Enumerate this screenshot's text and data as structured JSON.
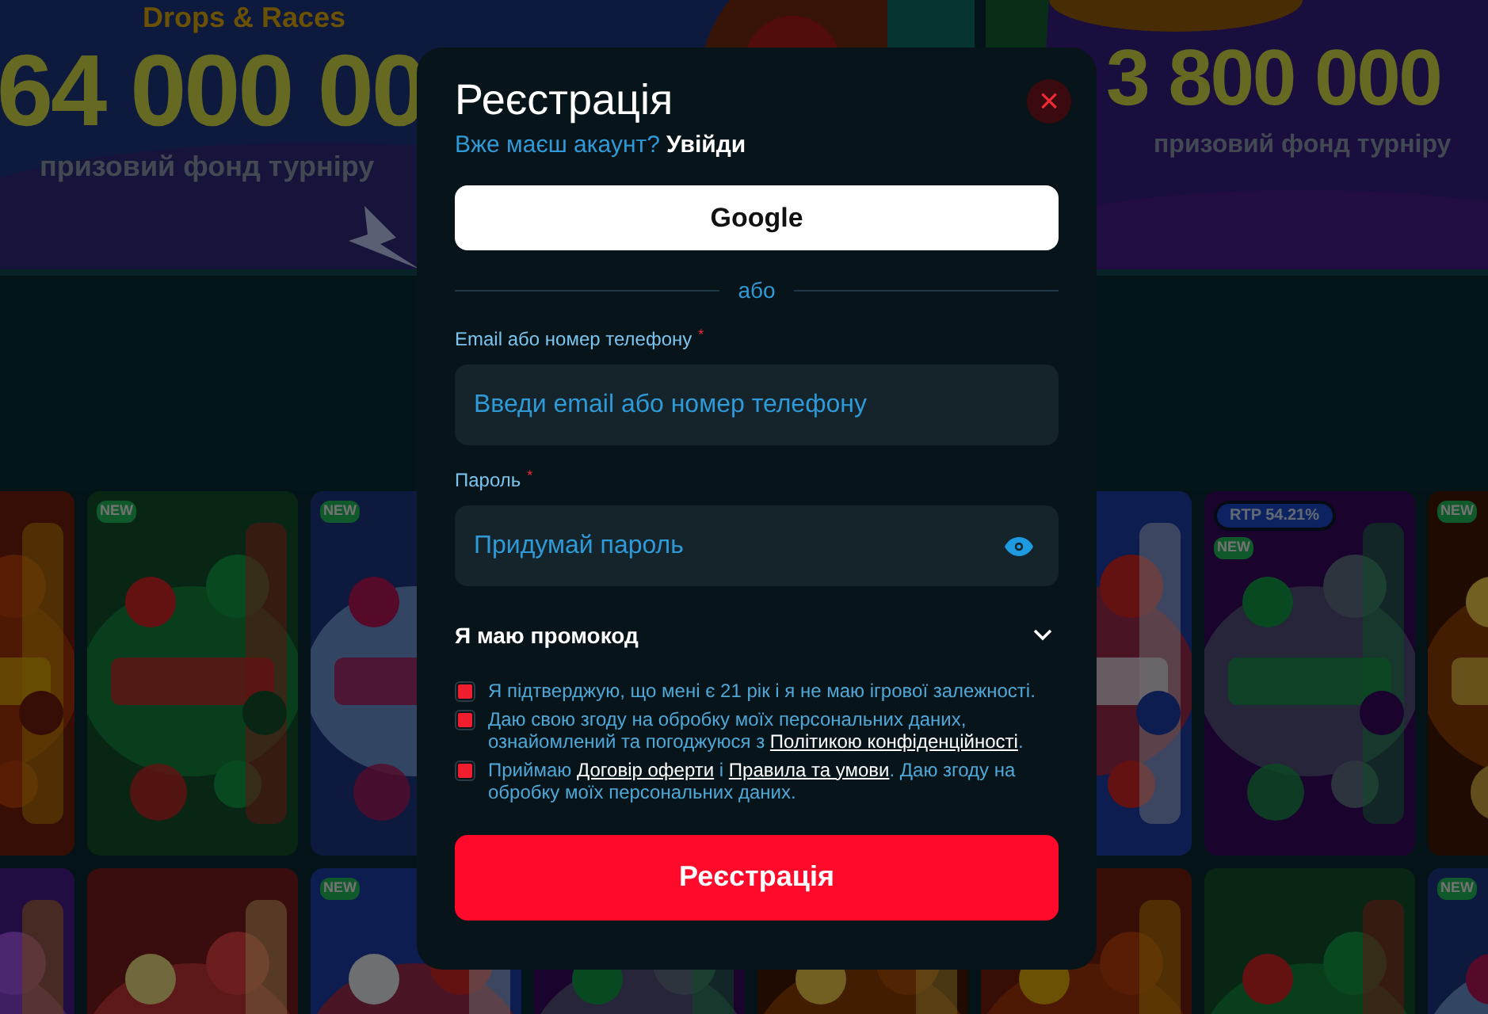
{
  "banners": [
    {
      "heading": "Drops & Races",
      "amount": "64 000 00",
      "caption": "призовий фонд турніру"
    },
    {
      "amount": "3 800 000",
      "caption": "призовий фонд турніру"
    }
  ],
  "game_rows": [
    [
      {},
      {
        "badges": [
          {
            "kind": "new",
            "label": "NEW"
          }
        ]
      },
      {
        "badges": [
          {
            "kind": "new",
            "label": "NEW"
          }
        ]
      },
      {},
      {},
      {},
      {
        "badges": [
          {
            "kind": "rtp",
            "label": "RTP 54.21%"
          },
          {
            "kind": "new",
            "label": "NEW"
          }
        ]
      },
      {
        "badges": [
          {
            "kind": "new",
            "label": "NEW"
          }
        ]
      }
    ],
    [
      {},
      {},
      {
        "badges": [
          {
            "kind": "new",
            "label": "NEW"
          }
        ]
      },
      {},
      {},
      {},
      {},
      {
        "badges": [
          {
            "kind": "new",
            "label": "NEW"
          }
        ]
      }
    ]
  ],
  "modal": {
    "title": "Реєстрація",
    "close": "×",
    "login_prompt": "Вже маєш акаунт?",
    "login_link": "Увійди",
    "google_button": "Google",
    "divider": "або",
    "fields": [
      {
        "label": "Email або номер телефону",
        "required_mark": "*",
        "placeholder": "Введи email або номер телефону",
        "kind": "text"
      },
      {
        "label": "Пароль",
        "required_mark": "*",
        "placeholder": "Придумай пароль",
        "kind": "password"
      }
    ],
    "promo": {
      "label": "Я маю промокод",
      "expanded": false
    },
    "consents": [
      {
        "checked": true,
        "parts": [
          {
            "text": "Я підтверджую, що мені є 21 рік і я не маю ігрової залежності.",
            "link": false
          }
        ]
      },
      {
        "checked": true,
        "parts": [
          {
            "text": "Даю свою згоду на обробку моїх персональних даних, ознайомлений та погоджуюся з ",
            "link": false
          },
          {
            "text": "Політикою конфіденційності",
            "link": true
          },
          {
            "text": ".",
            "link": false
          }
        ]
      },
      {
        "checked": true,
        "parts": [
          {
            "text": "Приймаю ",
            "link": false
          },
          {
            "text": "Договір оферти",
            "link": true
          },
          {
            "text": " і ",
            "link": false
          },
          {
            "text": "Правила та умови",
            "link": true
          },
          {
            "text": ". Даю згоду на обробку моїх персональних даних.",
            "link": false
          }
        ]
      }
    ],
    "submit": "Реєстрація"
  }
}
